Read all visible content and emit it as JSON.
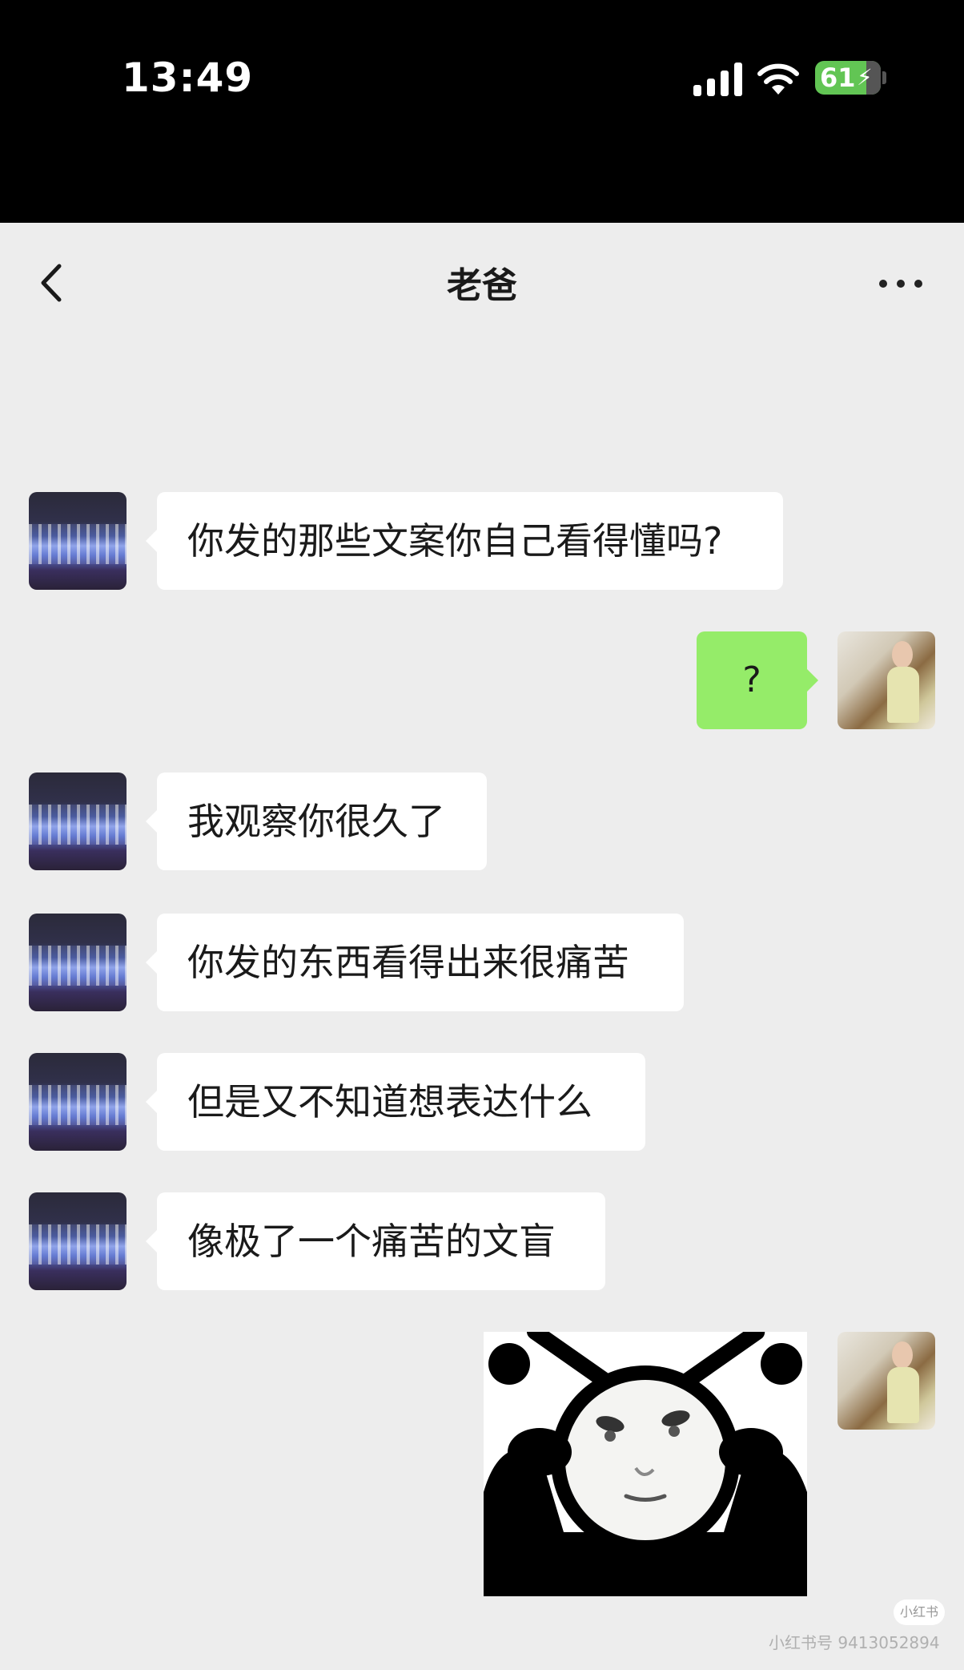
{
  "status_bar": {
    "time": "13:49",
    "battery": "61"
  },
  "header": {
    "title": "老爸"
  },
  "messages": [
    {
      "from": "dad",
      "text": "你发的那些文案你自己看得懂吗?"
    },
    {
      "from": "me",
      "text": "?"
    },
    {
      "from": "dad",
      "text": "我观察你很久了"
    },
    {
      "from": "dad",
      "text": "你发的东西看得出来很痛苦"
    },
    {
      "from": "dad",
      "text": "但是又不知道想表达什么"
    },
    {
      "from": "dad",
      "text": "像极了一个痛苦的文盲"
    },
    {
      "from": "me",
      "type": "sticker"
    }
  ],
  "watermark": {
    "logo": "小红书",
    "id": "小红书号 9413052894"
  }
}
